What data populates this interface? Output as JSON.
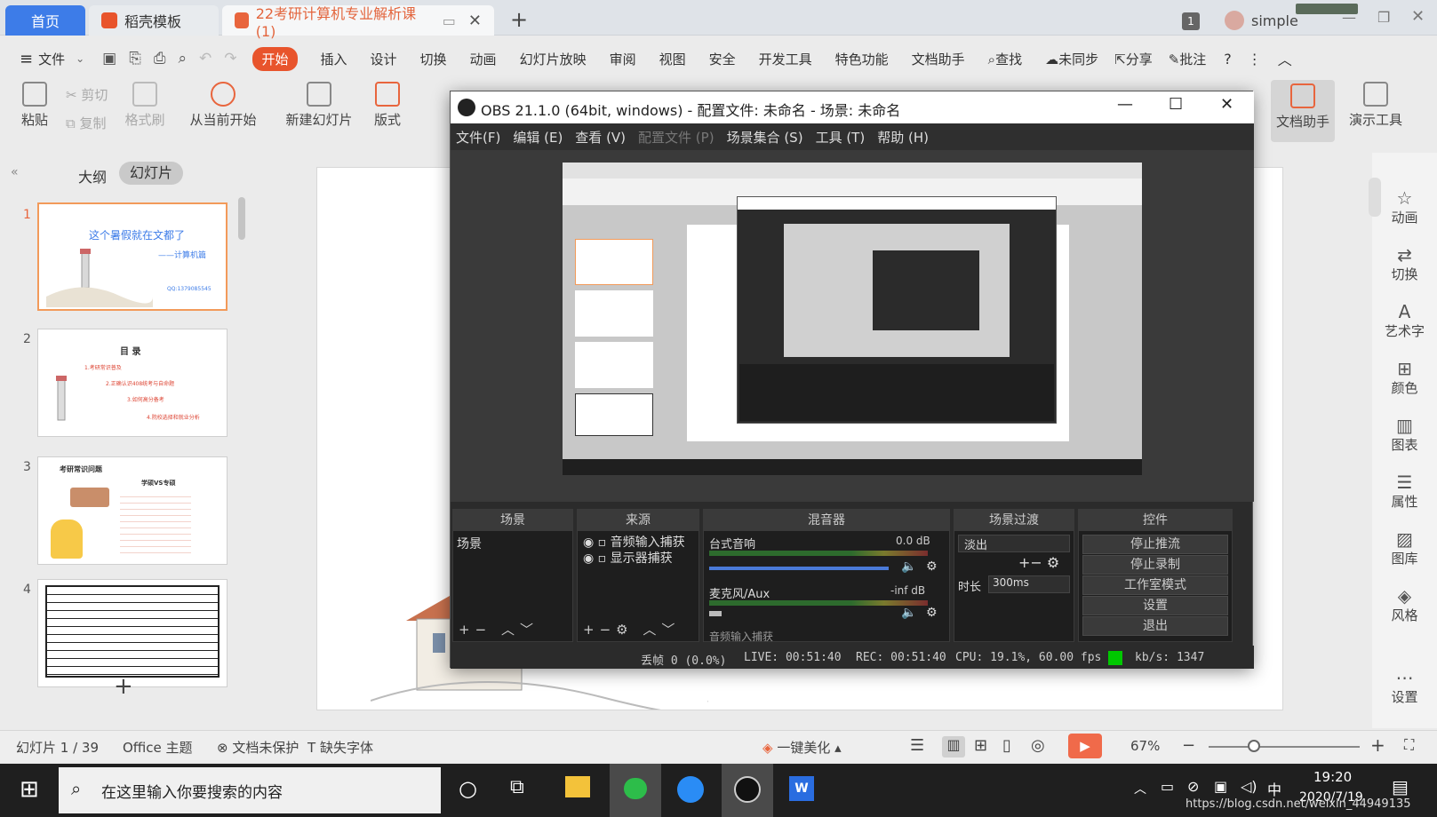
{
  "tabs": {
    "home": "首页",
    "daoke": "稻壳模板",
    "doc": "22考研计算机专业解析课 (1)",
    "new_tab": "+",
    "badge": "1",
    "user": "simple"
  },
  "menu": {
    "file": "文件",
    "start": "开始",
    "insert": "插入",
    "design": "设计",
    "switch": "切换",
    "animation": "动画",
    "slideshow": "幻灯片放映",
    "review": "审阅",
    "view": "视图",
    "security": "安全",
    "devtools": "开发工具",
    "special": "特色功能",
    "docassist": "文档助手",
    "find": "查找",
    "unsynced": "未同步",
    "share": "分享",
    "annotate": "批注"
  },
  "ribbon": {
    "paste": "粘贴",
    "cut": "剪切",
    "copy": "复制",
    "format_painter": "格式刷",
    "from_current": "从当前开始",
    "new_slide": "新建幻灯片",
    "layout": "版式",
    "doc_assist": "文档助手",
    "present_tools": "演示工具"
  },
  "left_panel": {
    "outline": "大纲",
    "slides": "幻灯片",
    "slide_numbers": [
      "1",
      "2",
      "3",
      "4"
    ],
    "slide1_title": "这个暑假就在文都了",
    "slide1_sub": "——计算机篇",
    "slide1_contact": "QQ:1379085545",
    "slide2_title": "目 录",
    "slide2_items": [
      "1.考研常识普及",
      "2.正确认识408统考与自命题",
      "3.如何高分备考",
      "4.院校选择和就业分析"
    ],
    "slide3_title": "考研常识问题",
    "slide3_sub": "学硕VS专硕",
    "add": "+"
  },
  "obs": {
    "title": "OBS 21.1.0 (64bit, windows) - 配置文件: 未命名 - 场景: 未命名",
    "menu": [
      "文件(F)",
      "编辑 (E)",
      "查看 (V)",
      "配置文件 (P)",
      "场景集合 (S)",
      "工具 (T)",
      "帮助 (H)"
    ],
    "docks": {
      "scenes": "场景",
      "sources": "来源",
      "mixer": "混音器",
      "transitions": "场景过渡",
      "controls": "控件"
    },
    "scene_item": "场景",
    "source_items": [
      "音频输入捕获",
      "显示器捕获"
    ],
    "mixer": {
      "desktop": "台式音响",
      "desktop_db": "0.0 dB",
      "mic": "麦克风/Aux",
      "mic_db": "-inf dB",
      "third": "音频输入捕获"
    },
    "transition": {
      "type": "淡出",
      "duration_label": "时长",
      "duration": "300ms"
    },
    "controls": [
      "停止推流",
      "停止录制",
      "工作室模式",
      "设置",
      "退出"
    ],
    "status": {
      "dropped": "丢帧 0 (0.0%)",
      "live": "LIVE: 00:51:40",
      "rec": "REC: 00:51:40",
      "cpu": "CPU: 19.1%, 60.00 fps",
      "kbs": "kb/s: 1347"
    }
  },
  "right_sidebar": [
    "动画",
    "切换",
    "艺术字",
    "颜色",
    "图表",
    "属性",
    "图库",
    "风格",
    "设置"
  ],
  "statusbar": {
    "slide": "幻灯片 1 / 39",
    "theme": "Office 主题",
    "protect": "文档未保护",
    "missing_font": "缺失字体",
    "beautify": "一键美化",
    "zoom": "67%"
  },
  "taskbar": {
    "search_placeholder": "在这里输入你要搜索的内容",
    "ime": "中",
    "time": "19:20",
    "date": "2020/7/19",
    "watermark": "https://blog.csdn.net/weixin_44949135"
  },
  "colors": {
    "accent": "#3d7ce8",
    "start_button": "#e8542c",
    "obs_bg": "#2b2b2b",
    "live_indicator": "#00c800"
  }
}
